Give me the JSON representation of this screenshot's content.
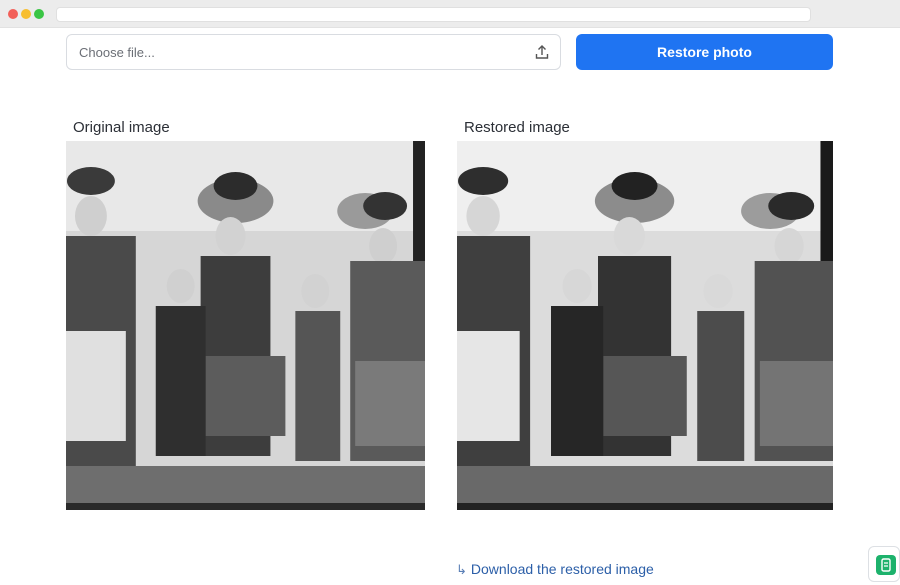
{
  "file_picker": {
    "placeholder": "Choose file...",
    "icon": "upload-icon"
  },
  "actions": {
    "restore_label": "Restore photo"
  },
  "panels": {
    "original_label": "Original image",
    "restored_label": "Restored image"
  },
  "download": {
    "arrow": "↳",
    "label": "Download the restored image"
  },
  "widget": {
    "icon": "document-list-icon"
  },
  "colors": {
    "accent": "#1f74f2",
    "link": "#2c5fa8",
    "widget": "#1db26c"
  }
}
